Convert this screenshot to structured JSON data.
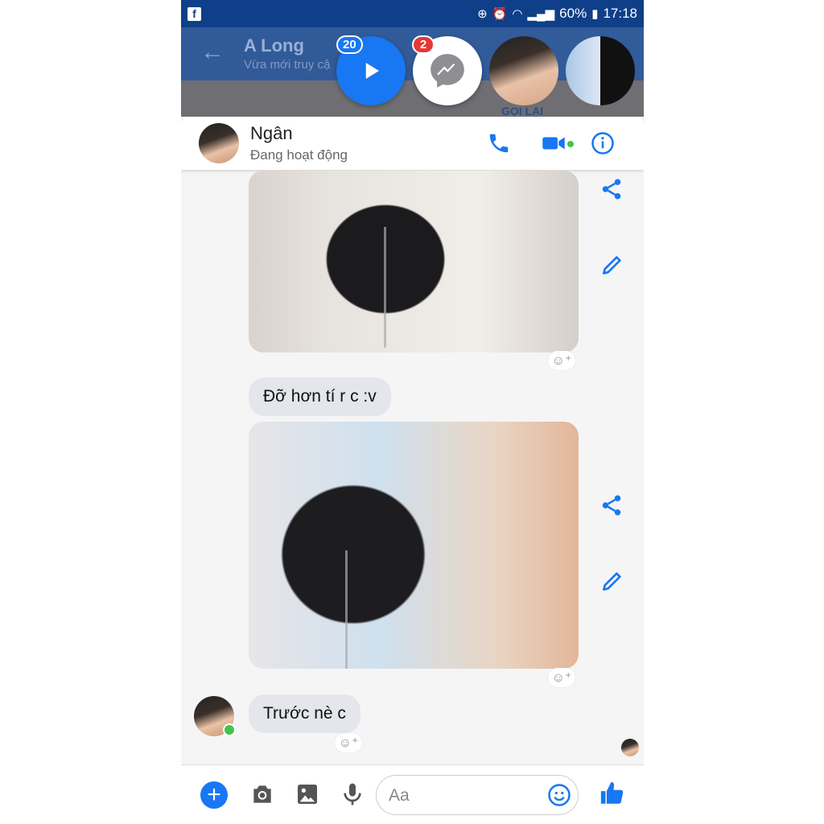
{
  "status_bar": {
    "battery": "60%",
    "time": "17:18"
  },
  "background_chat": {
    "title": "A Long",
    "subtitle": "Vừa mới truy cậ"
  },
  "chat_heads": {
    "play_badge": "20",
    "messenger_badge": "2",
    "call_again_label": "GỌI LẠI"
  },
  "conversation": {
    "contact_name": "Ngân",
    "contact_status": "Đang hoạt động",
    "messages": [
      {
        "type": "text",
        "text": "Đỡ hơn tí r c :v"
      },
      {
        "type": "text",
        "text": "Trước nè c"
      }
    ]
  },
  "composer": {
    "placeholder": "Aa"
  },
  "icons": {
    "accent_color": "#1877f2",
    "names": [
      "back-arrow-icon",
      "play-icon",
      "messenger-icon",
      "phone-icon",
      "video-icon",
      "info-icon",
      "share-icon",
      "edit-icon",
      "add-reaction-icon",
      "plus-icon",
      "camera-icon",
      "image-icon",
      "mic-icon",
      "emoji-icon",
      "thumbs-up-icon"
    ]
  }
}
